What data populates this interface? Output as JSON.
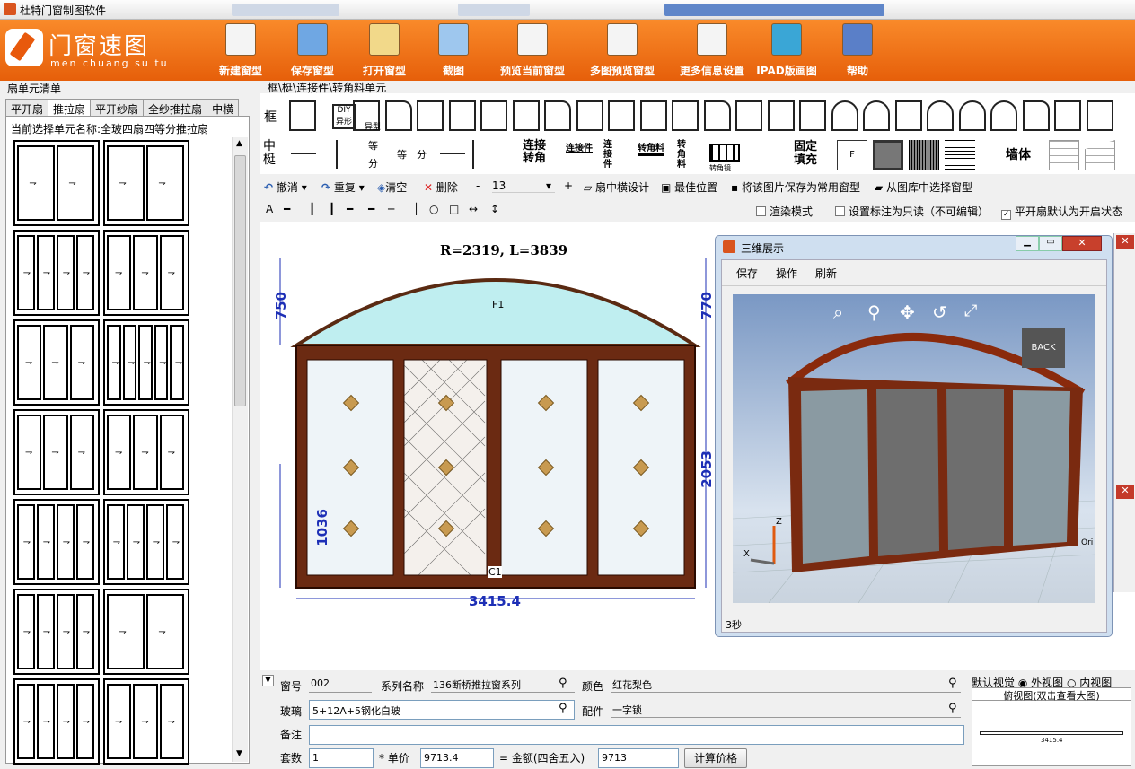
{
  "app": {
    "title": "杜特门窗制图软件"
  },
  "logo": {
    "title": "门窗速图",
    "subtitle": "men chuang su tu"
  },
  "toolbar": [
    {
      "label": "新建窗型",
      "icon": "new-doc-icon",
      "color": "#f4f4f4"
    },
    {
      "label": "保存窗型",
      "icon": "save-icon",
      "color": "#6fa7e3"
    },
    {
      "label": "打开窗型",
      "icon": "open-icon",
      "color": "#f2d98a"
    },
    {
      "label": "截图",
      "icon": "screenshot-icon",
      "color": "#9ec7ee"
    },
    {
      "label": "预览当前窗型",
      "icon": "preview-icon",
      "color": "#f4f4f4"
    },
    {
      "label": "多图预览窗型",
      "icon": "multi-preview-icon",
      "color": "#f4f4f4"
    },
    {
      "label": "更多信息设置",
      "icon": "settings-doc-icon",
      "color": "#f4f4f4"
    },
    {
      "label": "IPAD版画图",
      "icon": "ipad-icon",
      "color": "#3aa6d6"
    },
    {
      "label": "帮助",
      "icon": "help-books-icon",
      "color": "#5a7fc8"
    }
  ],
  "left": {
    "panel_title": "扇单元清单",
    "tabs": [
      "平开扇",
      "推拉扇",
      "平开纱扇",
      "全纱推拉扇",
      "中横"
    ],
    "active_tab": 1,
    "current_label": "当前选择单元名称:",
    "current_value": "全玻四扇四等分推拉扇"
  },
  "parts": {
    "breadcrumb": "框\\梃\\连接件\\转角料单元",
    "row1_label": "框",
    "row2_label": "中梃",
    "diy": "DIY异形",
    "yixing": "异型",
    "deng": "等",
    "fen": "分",
    "lianjie_zhuanjiao": "连接转角",
    "lianjiejian": "连接件",
    "lianjie_v": "连接件",
    "zhuanjiaoliao": "转角料",
    "zhuanjiao_v": "转角料",
    "zhuanjiaojing": "转角镜",
    "guding": "固定填充",
    "f": "F",
    "qiangti": "墙体"
  },
  "edit": {
    "undo": "撤消",
    "redo": "重复",
    "clear": "清空",
    "delete": "删除",
    "minus": "-",
    "num": "13",
    "plus": "+",
    "center_design": "扇中横设计",
    "best_pos": "最佳位置",
    "save_common": "将该图片保存为常用窗型",
    "pick_lib": "从图库中选择窗型",
    "render": "渲染模式",
    "readonly": "设置标注为只读（不可编辑）",
    "default_open": "平开扇默认为开启状态"
  },
  "drawing": {
    "arc": "R=2319, L=3839",
    "d750": "750",
    "d770": "770",
    "d2053": "2053",
    "d1036": "1036",
    "width": "3415.4",
    "f1": "F1",
    "c1": "C1"
  },
  "win3d": {
    "title": "三维展示",
    "menu": [
      "保存",
      "操作",
      "刷新"
    ],
    "status": "3秒",
    "back": "BACK",
    "z": "Z",
    "x": "X",
    "ori": "Ori"
  },
  "form": {
    "no_label": "窗号",
    "no": "002",
    "series_label": "系列名称",
    "series": "136断桥推拉窗系列",
    "color_label": "颜色",
    "color": "红花梨色",
    "glass_label": "玻璃",
    "glass": "5+12A+5钢化白玻",
    "fit_label": "配件",
    "fit": "一字锁",
    "note_label": "备注",
    "note": "",
    "qty_label": "套数",
    "qty": "1",
    "price_label": "* 单价",
    "price": "9713.4",
    "amount_label": "= 金额(四舍五入)",
    "amount": "9713",
    "calc": "计算价格"
  },
  "viewopt": {
    "label": "默认视觉",
    "outer": "外视图",
    "inner": "内视图",
    "thumb_title": "俯视图(双击查看大图)",
    "thumb_dim": "3415.4"
  }
}
